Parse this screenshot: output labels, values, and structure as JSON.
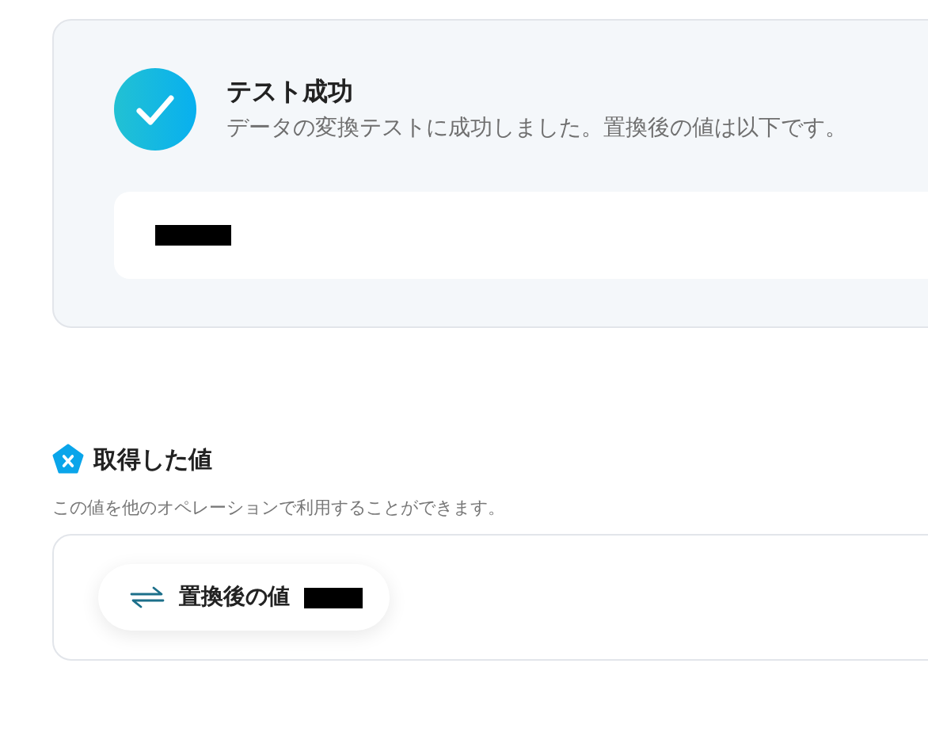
{
  "test_result": {
    "success": true,
    "title": "テスト成功",
    "message": "データの変換テストに成功しました。置換後の値は以下です。"
  },
  "output_section": {
    "title": "取得した値",
    "description": "この値を他のオペレーションで利用することができます。",
    "values": [
      {
        "label": "置換後の値"
      }
    ]
  }
}
